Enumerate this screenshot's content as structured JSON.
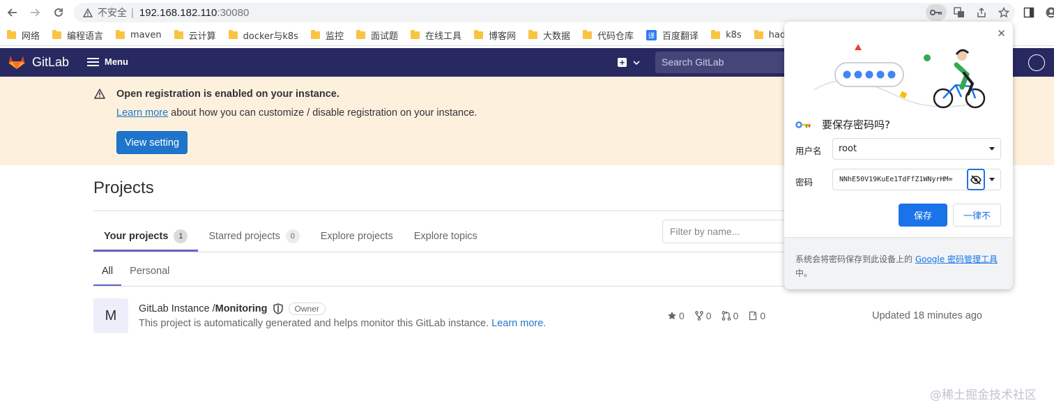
{
  "browser": {
    "insecure_label": "不安全",
    "separator": "|",
    "host": "192.168.182.110",
    "port": ":30080"
  },
  "bookmarks": [
    {
      "label": "网络",
      "icon": "folder-icon"
    },
    {
      "label": "编程语言",
      "icon": "folder-icon"
    },
    {
      "label": "maven",
      "icon": "folder-icon"
    },
    {
      "label": "云计算",
      "icon": "folder-icon"
    },
    {
      "label": "docker与k8s",
      "icon": "folder-icon"
    },
    {
      "label": "监控",
      "icon": "folder-icon"
    },
    {
      "label": "面试题",
      "icon": "folder-icon"
    },
    {
      "label": "在线工具",
      "icon": "folder-icon"
    },
    {
      "label": "博客网",
      "icon": "folder-icon"
    },
    {
      "label": "大数据",
      "icon": "folder-icon"
    },
    {
      "label": "代码仓库",
      "icon": "folder-icon"
    },
    {
      "label": "百度翻译",
      "icon": "translate-icon",
      "icon_text": "译"
    },
    {
      "label": "k8s",
      "icon": "folder-icon"
    },
    {
      "label": "hadoop",
      "icon": "folder-icon"
    }
  ],
  "gitlab": {
    "brand": "GitLab",
    "menu_label": "Menu",
    "search_placeholder": "Search GitLab"
  },
  "banner": {
    "title": "Open registration is enabled on your instance.",
    "link": "Learn more",
    "body": " about how you can customize / disable registration on your instance.",
    "button": "View setting"
  },
  "projects": {
    "title": "Projects",
    "tabs": [
      {
        "label": "Your projects",
        "count": "1"
      },
      {
        "label": "Starred projects",
        "count": "0"
      },
      {
        "label": "Explore projects"
      },
      {
        "label": "Explore topics"
      }
    ],
    "filter_placeholder": "Filter by name...",
    "subtabs": [
      "All",
      "Personal"
    ],
    "items": [
      {
        "avatar_letter": "M",
        "namespace": "GitLab Instance / ",
        "name": "Monitoring",
        "badge": "Owner",
        "description": "This project is automatically generated and helps monitor this GitLab instance. ",
        "description_link": "Learn more.",
        "stars": "0",
        "forks": "0",
        "merge_requests": "0",
        "issues": "0",
        "updated": "Updated 18 minutes ago"
      }
    ]
  },
  "password_popup": {
    "title": "要保存密码吗?",
    "username_label": "用户名",
    "username_value": "root",
    "password_label": "密码",
    "password_value": "NNhE50V19KuEe1TdFfZ1WNyrHM=",
    "save_button": "保存",
    "never_button": "一律不",
    "footer_text": "系统会将密码保存到此设备上的 ",
    "footer_link": "Google 密码管理工具",
    "footer_suffix": "中。",
    "colors": {
      "primary": "#1a73e8"
    }
  },
  "watermark": "@稀土掘金技术社区",
  "colors": {
    "gitlab_header": "#292961",
    "banner_bg": "#fdf1dd",
    "link": "#1f75cb",
    "tab_indicator": "#6666c4"
  }
}
